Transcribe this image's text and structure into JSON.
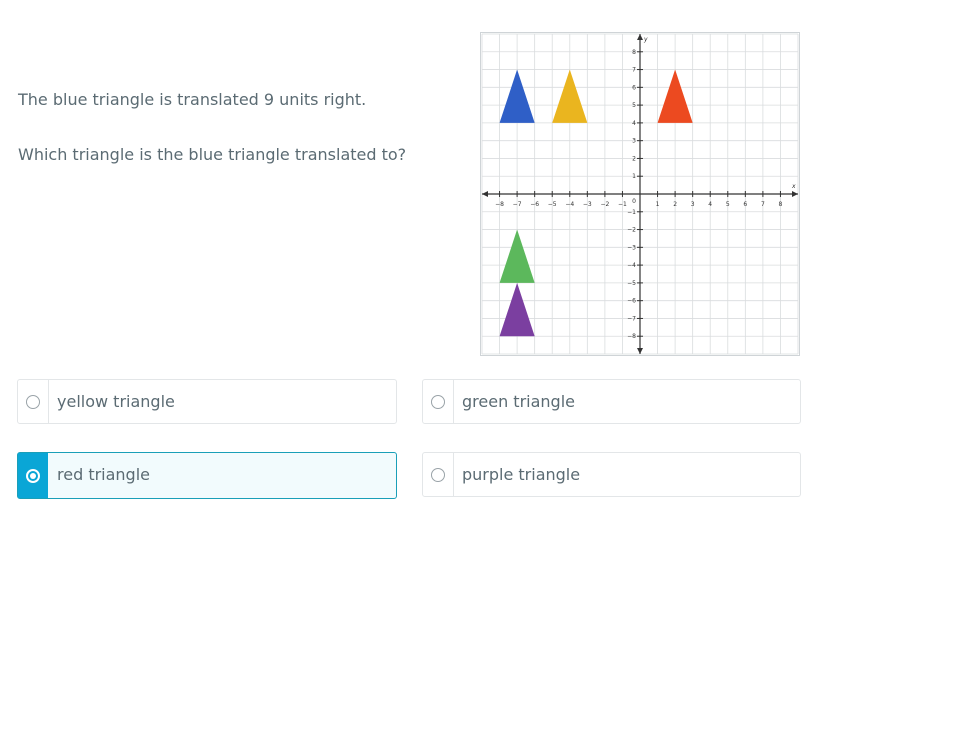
{
  "question": {
    "line1": "The blue triangle is translated 9 units right.",
    "line2": "Which triangle is the blue triangle translated to?"
  },
  "graph": {
    "x_tick_labels": [
      "−8",
      "−7",
      "−6",
      "−5",
      "−4",
      "−3",
      "−2",
      "−1",
      "1",
      "2",
      "3",
      "4",
      "5",
      "6",
      "7",
      "8"
    ],
    "y_tick_labels": [
      "8",
      "7",
      "6",
      "5",
      "4",
      "3",
      "2",
      "1",
      "−1",
      "−2",
      "−3",
      "−4",
      "−5",
      "−6",
      "−7",
      "−8"
    ],
    "origin_label": "0",
    "x_axis_label": "x",
    "y_axis_label": "y",
    "x_range": [
      -9,
      9
    ],
    "y_range": [
      -9,
      9
    ],
    "grid": true,
    "triangles": [
      {
        "name": "blue",
        "color": "#2f5fc7",
        "vertices": [
          [
            -8,
            4
          ],
          [
            -6,
            4
          ],
          [
            -7,
            7
          ]
        ]
      },
      {
        "name": "yellow",
        "color": "#eab51f",
        "vertices": [
          [
            -5,
            4
          ],
          [
            -3,
            4
          ],
          [
            -4,
            7
          ]
        ]
      },
      {
        "name": "red",
        "color": "#ec4a20",
        "vertices": [
          [
            1,
            4
          ],
          [
            3,
            4
          ],
          [
            2,
            7
          ]
        ]
      },
      {
        "name": "green",
        "color": "#5cb85c",
        "vertices": [
          [
            -8,
            -5
          ],
          [
            -6,
            -5
          ],
          [
            -7,
            -2
          ]
        ]
      },
      {
        "name": "purple",
        "color": "#7b3fa0",
        "vertices": [
          [
            -8,
            -8
          ],
          [
            -6,
            -8
          ],
          [
            -7,
            -5
          ]
        ]
      }
    ]
  },
  "options": {
    "yellow": {
      "label": "yellow triangle",
      "selected": false
    },
    "green": {
      "label": "green triangle",
      "selected": false
    },
    "red": {
      "label": "red triangle",
      "selected": true
    },
    "purple": {
      "label": "purple triangle",
      "selected": false
    }
  },
  "colors": {
    "accent": "#0aa6d6",
    "text": "#5b6b73"
  }
}
